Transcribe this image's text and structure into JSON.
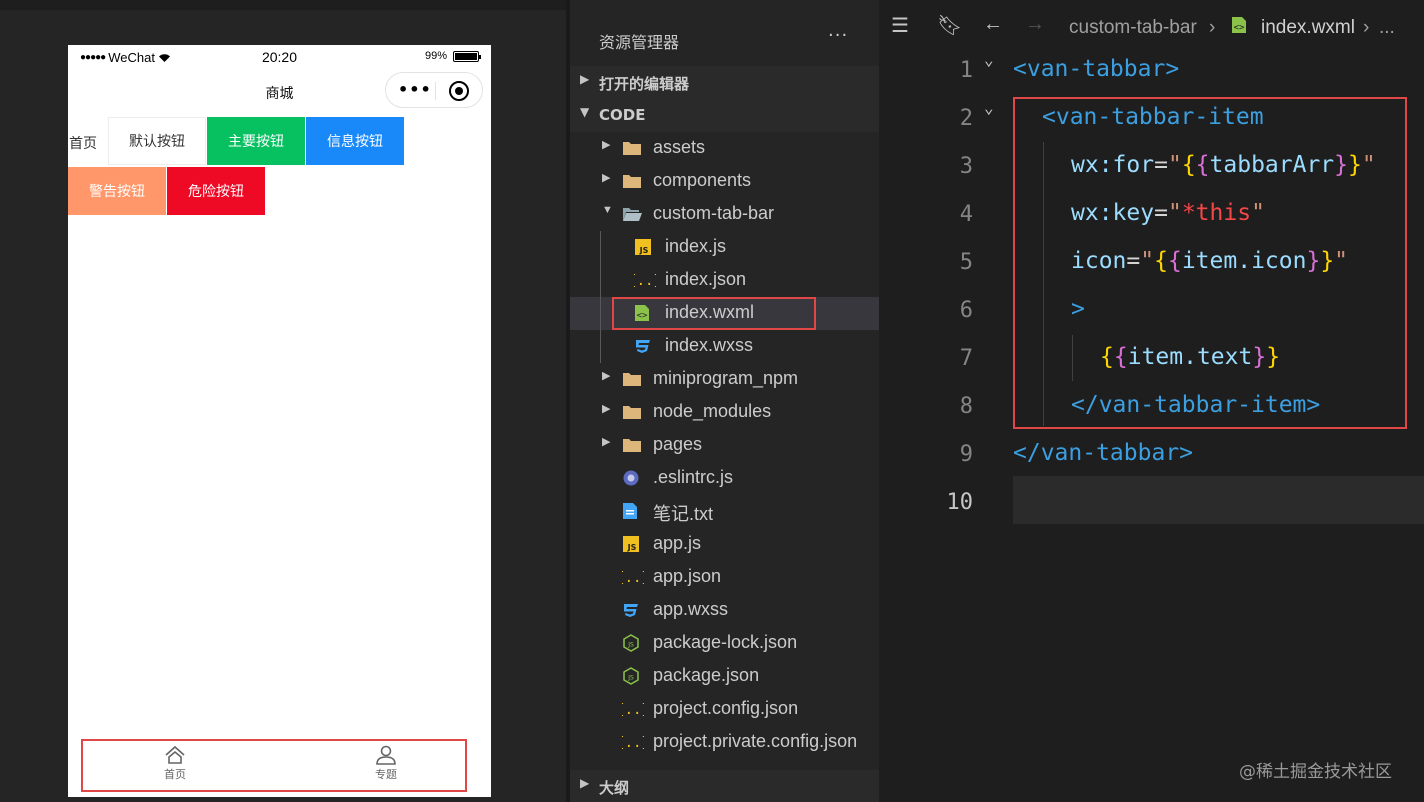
{
  "simulator": {
    "status": {
      "carrier": "WeChat",
      "time": "20:20",
      "battery": "99%",
      "battery_level": 0.99
    },
    "nav_title": "商城",
    "page_label": "首页",
    "buttons": {
      "default": "默认按钮",
      "primary": "主要按钮",
      "info": "信息按钮",
      "warning": "警告按钮",
      "danger": "危险按钮"
    },
    "tabbar": {
      "home": "首页",
      "topic": "专题"
    }
  },
  "explorer": {
    "title": "资源管理器",
    "more": "···",
    "sections": {
      "open_editors": "打开的编辑器",
      "code": "CODE",
      "outline": "大纲"
    },
    "tree": [
      {
        "name": "assets",
        "kind": "folder"
      },
      {
        "name": "components",
        "kind": "folder"
      },
      {
        "name": "custom-tab-bar",
        "kind": "folder-open"
      },
      {
        "name": "index.js",
        "kind": "js"
      },
      {
        "name": "index.json",
        "kind": "json"
      },
      {
        "name": "index.wxml",
        "kind": "wxml"
      },
      {
        "name": "index.wxss",
        "kind": "wxss"
      },
      {
        "name": "miniprogram_npm",
        "kind": "folder"
      },
      {
        "name": "node_modules",
        "kind": "folder"
      },
      {
        "name": "pages",
        "kind": "folder"
      },
      {
        "name": ".eslintrc.js",
        "kind": "eslint"
      },
      {
        "name": "笔记.txt",
        "kind": "txt"
      },
      {
        "name": "app.js",
        "kind": "js"
      },
      {
        "name": "app.json",
        "kind": "json"
      },
      {
        "name": "app.wxss",
        "kind": "wxss"
      },
      {
        "name": "package-lock.json",
        "kind": "node"
      },
      {
        "name": "package.json",
        "kind": "node"
      },
      {
        "name": "project.config.json",
        "kind": "json"
      },
      {
        "name": "project.private.config.json",
        "kind": "json"
      }
    ]
  },
  "editor": {
    "breadcrumb": {
      "folder": "custom-tab-bar",
      "file": "index.wxml",
      "tail": "..."
    },
    "lines": [
      {
        "n": "1",
        "tokens": [
          [
            "tag",
            "<van-tabbar>"
          ]
        ]
      },
      {
        "n": "2",
        "tokens": [
          [
            "tag",
            "<van-tabbar-item"
          ]
        ]
      },
      {
        "n": "3",
        "tokens": [
          [
            "attr",
            "wx:for"
          ],
          [
            "eq",
            "="
          ],
          [
            "str",
            "\""
          ],
          [
            "brace1",
            "{"
          ],
          [
            "brace2",
            "{"
          ],
          [
            "expr",
            "tabbarArr"
          ],
          [
            "brace2",
            "}"
          ],
          [
            "brace1",
            "}"
          ],
          [
            "str",
            "\""
          ]
        ]
      },
      {
        "n": "4",
        "tokens": [
          [
            "attr",
            "wx:key"
          ],
          [
            "eq",
            "="
          ],
          [
            "str",
            "\""
          ],
          [
            "this",
            "*this"
          ],
          [
            "str",
            "\""
          ]
        ]
      },
      {
        "n": "5",
        "tokens": [
          [
            "attr",
            "icon"
          ],
          [
            "eq",
            "="
          ],
          [
            "str",
            "\""
          ],
          [
            "brace1",
            "{"
          ],
          [
            "brace2",
            "{"
          ],
          [
            "expr",
            "item.icon"
          ],
          [
            "brace2",
            "}"
          ],
          [
            "brace1",
            "}"
          ],
          [
            "str",
            "\""
          ]
        ]
      },
      {
        "n": "6",
        "tokens": [
          [
            "tag",
            ">"
          ]
        ]
      },
      {
        "n": "7",
        "tokens": [
          [
            "brace1",
            "{"
          ],
          [
            "brace2",
            "{"
          ],
          [
            "expr",
            "item.text"
          ],
          [
            "brace2",
            "}"
          ],
          [
            "brace1",
            "}"
          ]
        ]
      },
      {
        "n": "8",
        "tokens": [
          [
            "tag",
            "</van-tabbar-item>"
          ]
        ]
      },
      {
        "n": "9",
        "tokens": [
          [
            "tag",
            "</van-tabbar>"
          ]
        ]
      },
      {
        "n": "10",
        "tokens": []
      }
    ],
    "watermark": "@稀土掘金技术社区"
  },
  "colors": {
    "annotation_red": "#e04848",
    "wx_primary": "#07c160",
    "wx_info": "#1989fa",
    "wx_warning": "#ff976a",
    "wx_danger": "#ee0a24"
  }
}
